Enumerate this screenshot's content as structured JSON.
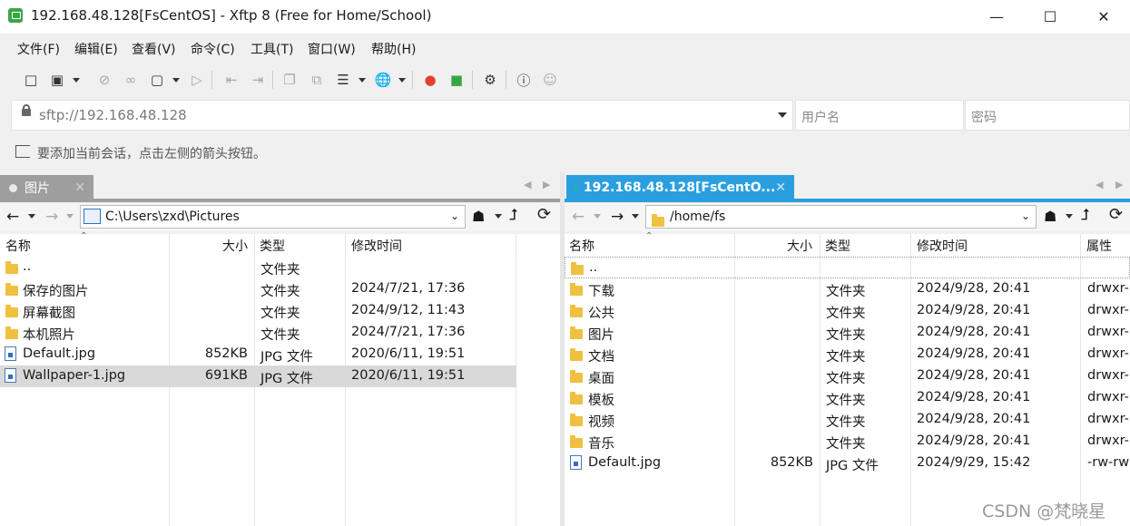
{
  "window": {
    "title": "192.168.48.128[FsCentOS] - Xftp 8 (Free for Home/School)"
  },
  "menu": [
    "文件(F)",
    "编辑(E)",
    "查看(V)",
    "命令(C)",
    "工具(T)",
    "窗口(W)",
    "帮助(H)"
  ],
  "address": {
    "url": "sftp://192.168.48.128",
    "username_placeholder": "用户名",
    "password_placeholder": "密码"
  },
  "hint": "要添加当前会话，点击左侧的箭头按钮。",
  "left_pane": {
    "tab": "图片",
    "path": "C:\\Users\\zxd\\Pictures",
    "columns": [
      "名称",
      "大小",
      "类型",
      "修改时间"
    ],
    "rows": [
      {
        "name": "..",
        "size": "",
        "type": "文件夹",
        "modified": "",
        "kind": "folder"
      },
      {
        "name": "保存的图片",
        "size": "",
        "type": "文件夹",
        "modified": "2024/7/21, 17:36",
        "kind": "folder"
      },
      {
        "name": "屏幕截图",
        "size": "",
        "type": "文件夹",
        "modified": "2024/9/12, 11:43",
        "kind": "folder"
      },
      {
        "name": "本机照片",
        "size": "",
        "type": "文件夹",
        "modified": "2024/7/21, 17:36",
        "kind": "folder"
      },
      {
        "name": "Default.jpg",
        "size": "852KB",
        "type": "JPG 文件",
        "modified": "2020/6/11, 19:51",
        "kind": "file"
      },
      {
        "name": "Wallpaper-1.jpg",
        "size": "691KB",
        "type": "JPG 文件",
        "modified": "2020/6/11, 19:51",
        "kind": "file",
        "selected": true
      }
    ]
  },
  "right_pane": {
    "tab": "192.168.48.128[FsCentO...",
    "path": "/home/fs",
    "columns": [
      "名称",
      "大小",
      "类型",
      "修改时间",
      "属性"
    ],
    "rows": [
      {
        "name": "..",
        "size": "",
        "type": "",
        "modified": "",
        "attr": "",
        "kind": "folder"
      },
      {
        "name": "下载",
        "size": "",
        "type": "文件夹",
        "modified": "2024/9/28, 20:41",
        "attr": "drwxr-",
        "kind": "folder"
      },
      {
        "name": "公共",
        "size": "",
        "type": "文件夹",
        "modified": "2024/9/28, 20:41",
        "attr": "drwxr-",
        "kind": "folder"
      },
      {
        "name": "图片",
        "size": "",
        "type": "文件夹",
        "modified": "2024/9/28, 20:41",
        "attr": "drwxr-",
        "kind": "folder"
      },
      {
        "name": "文档",
        "size": "",
        "type": "文件夹",
        "modified": "2024/9/28, 20:41",
        "attr": "drwxr-",
        "kind": "folder"
      },
      {
        "name": "桌面",
        "size": "",
        "type": "文件夹",
        "modified": "2024/9/28, 20:41",
        "attr": "drwxr-",
        "kind": "folder"
      },
      {
        "name": "模板",
        "size": "",
        "type": "文件夹",
        "modified": "2024/9/28, 20:41",
        "attr": "drwxr-",
        "kind": "folder"
      },
      {
        "name": "视频",
        "size": "",
        "type": "文件夹",
        "modified": "2024/9/28, 20:41",
        "attr": "drwxr-",
        "kind": "folder"
      },
      {
        "name": "音乐",
        "size": "",
        "type": "文件夹",
        "modified": "2024/9/28, 20:41",
        "attr": "drwxr-",
        "kind": "folder"
      },
      {
        "name": "Default.jpg",
        "size": "852KB",
        "type": "JPG 文件",
        "modified": "2024/9/29, 15:42",
        "attr": "-rw-rw",
        "kind": "file"
      }
    ]
  },
  "watermark": "CSDN @梵晓星",
  "colors": {
    "active_tab": "#2a9fe0",
    "inactive_tab": "#9e9e9e",
    "selected_row": "#d9d9d9",
    "connected_dot": "#21d021"
  }
}
